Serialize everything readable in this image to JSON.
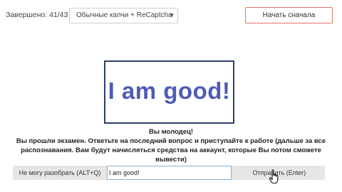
{
  "header": {
    "counter_label": "Завершено:",
    "counter_value": "41/43",
    "captcha_type": {
      "selected": "Обычные капчи + ReCaptcha",
      "arrow_icon": "triangle-down-icon"
    },
    "restart_label": "Начать сначала",
    "restart_border_color": "#e2726a"
  },
  "captcha": {
    "text": "I am good!",
    "text_color": "#4c5cb5",
    "border_color": "#2d3e6e"
  },
  "message": {
    "title": "Вы молодец!",
    "line1": "Вы прошли экзамен. Ответьте на последний вопрос и приступайте к работе (дальше за все",
    "line2": "распознавания. Вам будут начисляться средства на аккаунт, которые Вы потом сможете",
    "line3": "вывести)"
  },
  "answer_bar": {
    "skip_label": "Не могу разобрать (ALT+Q)",
    "input_value": "I am good!",
    "submit_label": "Отправить (Enter)"
  },
  "cursor": {
    "icon": "hand-pointer-icon"
  }
}
